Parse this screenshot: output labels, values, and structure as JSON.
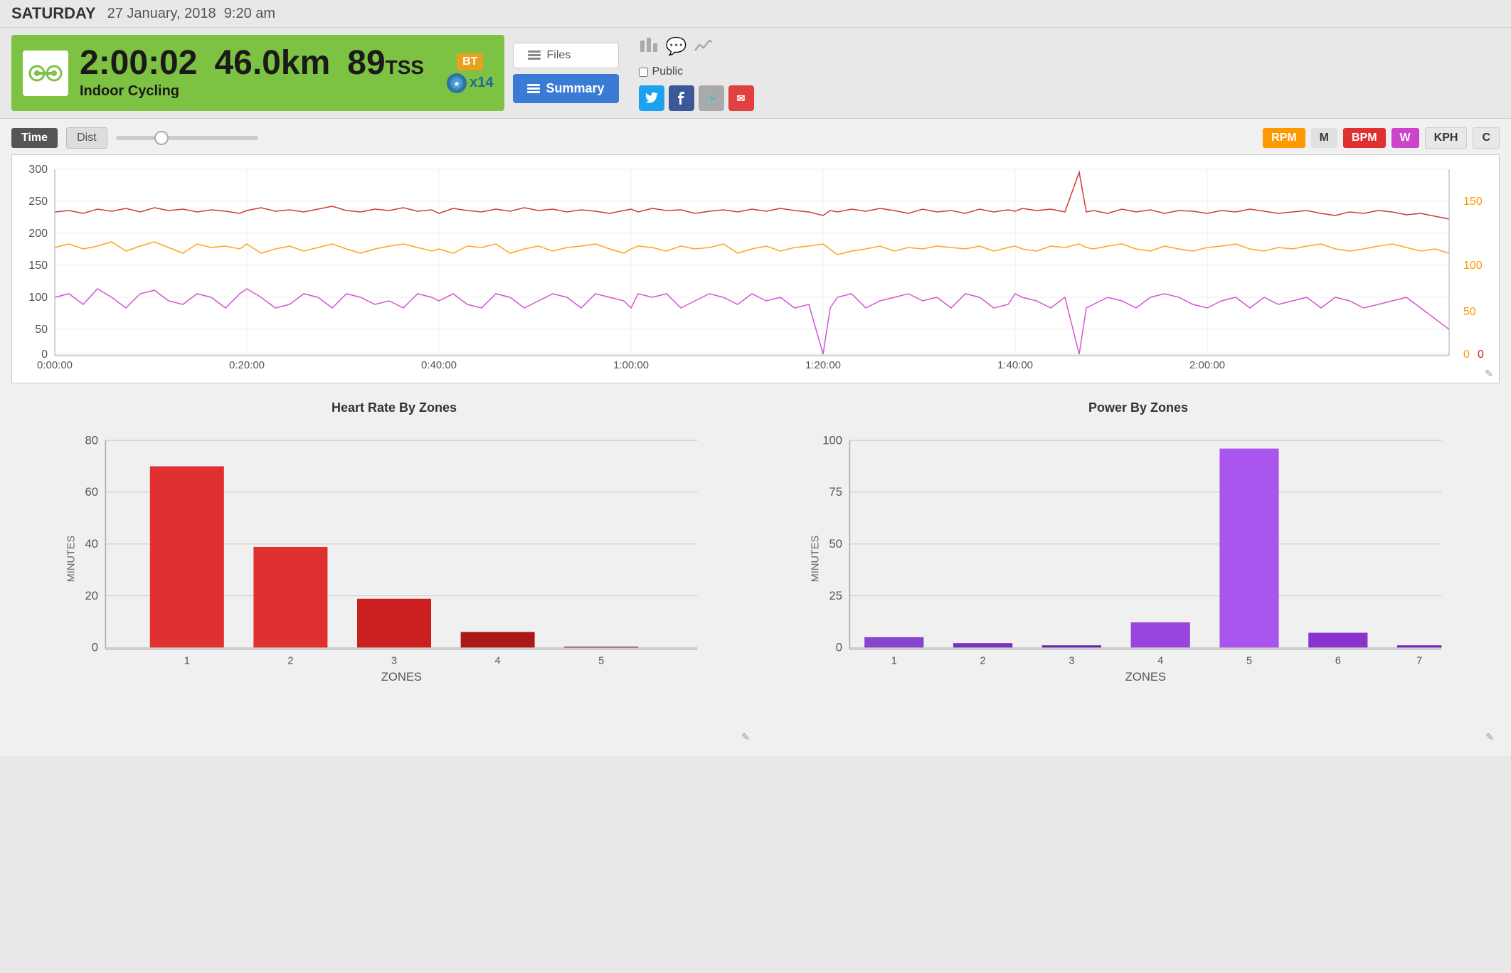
{
  "header": {
    "day": "SATURDAY",
    "date": "27 January, 2018",
    "time": "9:20 am"
  },
  "activity": {
    "duration": "2:00:02",
    "distance": "46.0km",
    "tss": "89",
    "tss_label": "TSS",
    "type": "Indoor Cycling",
    "badge_bt": "BT",
    "badge_medal": "x14"
  },
  "toolbar": {
    "files_label": "Files",
    "summary_label": "Summary",
    "public_label": "Public"
  },
  "chart_controls": {
    "time_label": "Time",
    "dist_label": "Dist",
    "rpm_label": "RPM",
    "m_label": "M",
    "bpm_label": "BPM",
    "w_label": "W",
    "kph_label": "KPH",
    "c_label": "C"
  },
  "time_axis": [
    "0:00:00",
    "0:20:00",
    "0:40:00",
    "1:00:00",
    "1:20:00",
    "1:40:00",
    "2:00:00"
  ],
  "left_axis": [
    "300",
    "250",
    "200",
    "150",
    "100",
    "50",
    "0"
  ],
  "right_axis_orange": [
    "150",
    "100",
    "50",
    "0"
  ],
  "right_axis_red": [
    "0"
  ],
  "heart_rate_chart": {
    "title": "Heart Rate By Zones",
    "x_label": "ZONES",
    "y_label": "MINUTES",
    "bars": [
      {
        "zone": "1",
        "value": 70,
        "color": "#e03030"
      },
      {
        "zone": "2",
        "value": 39,
        "color": "#e03030"
      },
      {
        "zone": "3",
        "value": 19,
        "color": "#cc2020"
      },
      {
        "zone": "4",
        "value": 6,
        "color": "#aa1010"
      },
      {
        "zone": "5",
        "value": 0,
        "color": "#880000"
      }
    ],
    "y_max": 80,
    "y_ticks": [
      0,
      20,
      40,
      60,
      80
    ]
  },
  "power_chart": {
    "title": "Power By Zones",
    "x_label": "ZONES",
    "y_label": "MINUTES",
    "bars": [
      {
        "zone": "1",
        "value": 5,
        "color": "#8844cc"
      },
      {
        "zone": "2",
        "value": 2,
        "color": "#7733bb"
      },
      {
        "zone": "3",
        "value": 1,
        "color": "#6622aa"
      },
      {
        "zone": "4",
        "value": 12,
        "color": "#9944dd"
      },
      {
        "zone": "5",
        "value": 96,
        "color": "#aa55ee"
      },
      {
        "zone": "6",
        "value": 7,
        "color": "#8833cc"
      },
      {
        "zone": "7",
        "value": 1,
        "color": "#7722bb"
      }
    ],
    "y_max": 100,
    "y_ticks": [
      0,
      25,
      50,
      75,
      100
    ]
  },
  "social": {
    "twitter": "T",
    "facebook": "f",
    "link": "🔗",
    "email": "✉"
  }
}
